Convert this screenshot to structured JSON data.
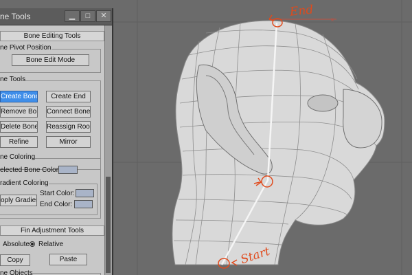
{
  "window": {
    "title": "ne Tools",
    "minimize": "▁",
    "maximize": "□",
    "close": "✕"
  },
  "rollouts": {
    "bone_editing": {
      "header": "Bone Editing Tools",
      "pivot_group_label": "ne Pivot Position",
      "edit_mode_button": "Bone Edit Mode"
    },
    "bone_tools": {
      "group_label": "ne Tools",
      "create_bones": "Create Bones",
      "create_end": "Create End",
      "remove_bone": "Remove Bone",
      "connect_bones": "Connect Bones",
      "delete_bone": "Delete Bone",
      "reassign_root": "Reassign Root",
      "refine": "Refine",
      "mirror": "Mirror"
    },
    "bone_coloring": {
      "group_label": "ne Coloring",
      "selected_color_label": "elected Bone Color:",
      "gradient_group_label": "radient Coloring",
      "apply_gradient": "oply Gradient",
      "start_color_label": "Start Color:",
      "end_color_label": "End Color:"
    },
    "fin_adjustment": {
      "header": "Fin Adjustment Tools",
      "absolute_label": "Absolute",
      "relative_label": "Relative",
      "copy": "Copy",
      "paste": "Paste"
    },
    "bone_objects": {
      "group_label": "ne Objects"
    }
  },
  "annotations": {
    "end": "End",
    "start": "Start"
  },
  "colors": {
    "annotation": "#e04a1c",
    "active_button": "#3f8ee9",
    "swatch": "#a9b4c8"
  }
}
